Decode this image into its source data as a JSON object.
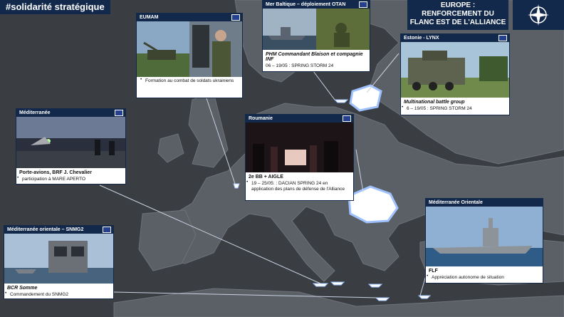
{
  "badge": "#solidarité stratégique",
  "title": [
    "EUROPE :",
    "RENFORCEMENT DU",
    "FLANC EST DE L'ALLIANCE"
  ],
  "icons": {
    "nato": "nato-compass-icon",
    "eu": "eu-flag-icon"
  },
  "colors": {
    "navy": "#13294b",
    "land": "#5b5f66",
    "sea": "#3a3d42",
    "highlight": "#ffffff"
  },
  "cards": {
    "eumam": {
      "header": "EUMAM",
      "bullet": "Formation au combat de soldats ukrainiens"
    },
    "baltic": {
      "header": "Mer Baltique – déploiement OTAN",
      "title": "PHM Commandant Blaison et compagnie INF",
      "date": "06 – 19/05 : SPRING STORM 24"
    },
    "estonia": {
      "header": "Estonie - LYNX",
      "title": "Multinational battle group",
      "date": "6 – 19/05 : SPRING STORM 24"
    },
    "med": {
      "header": "Méditerranée",
      "title": "Porte-avions, BRF J. Chevalier",
      "bullet": "participation à MARE APERTO"
    },
    "romania": {
      "header": "Roumanie",
      "title": "2e BB + AIGLE",
      "bullet": "19 – 25/05: : DACIAN SPRING 24 en application des plans de défense de l'Alliance"
    },
    "med_east": {
      "header": "Méditerranée Orientale",
      "title": "FLF",
      "bullet": "Appréciation autonome de situation"
    },
    "snmg2": {
      "header": "Méditerranée orientale – SNMG2",
      "title": "BCR Somme",
      "bullet": "Commandement du SNMG2"
    }
  }
}
